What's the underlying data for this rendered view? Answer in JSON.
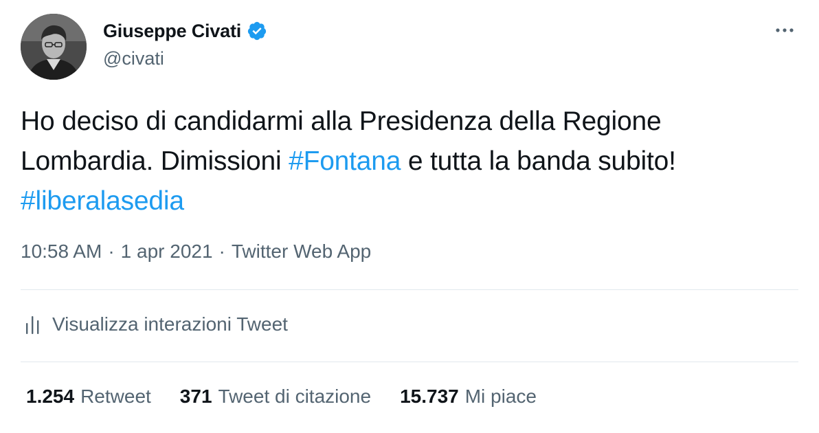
{
  "author": {
    "display_name": "Giuseppe Civati",
    "handle": "@civati",
    "verified": true,
    "avatar": "profile-photo-grayscale"
  },
  "tweet": {
    "text_parts": [
      {
        "text": "Ho deciso di candidarmi alla Presidenza della Regione Lombardia. Dimissioni ",
        "type": "text"
      },
      {
        "text": "#Fontana",
        "type": "hashtag"
      },
      {
        "text": " e tutta la banda subito! ",
        "type": "text"
      },
      {
        "text": "#liberalasedia",
        "type": "hashtag"
      }
    ]
  },
  "meta": {
    "time": "10:58 AM",
    "separator": "·",
    "date": "1 apr 2021",
    "source": "Twitter Web App"
  },
  "analytics": {
    "icon": "bar-chart-icon",
    "label": "Visualizza interazioni Tweet"
  },
  "stats": [
    {
      "count": "1.254",
      "label": "Retweet"
    },
    {
      "count": "371",
      "label": "Tweet di citazione"
    },
    {
      "count": "15.737",
      "label": "Mi piace"
    }
  ],
  "colors": {
    "link": "#1d9bf0",
    "secondary_text": "#536471",
    "primary_text": "#0f1419",
    "verified_badge": "#1d9bf0",
    "divider": "#e1e8ed"
  },
  "icons": {
    "more": "more-horizontal-icon",
    "verified": "verified-badge-icon"
  }
}
